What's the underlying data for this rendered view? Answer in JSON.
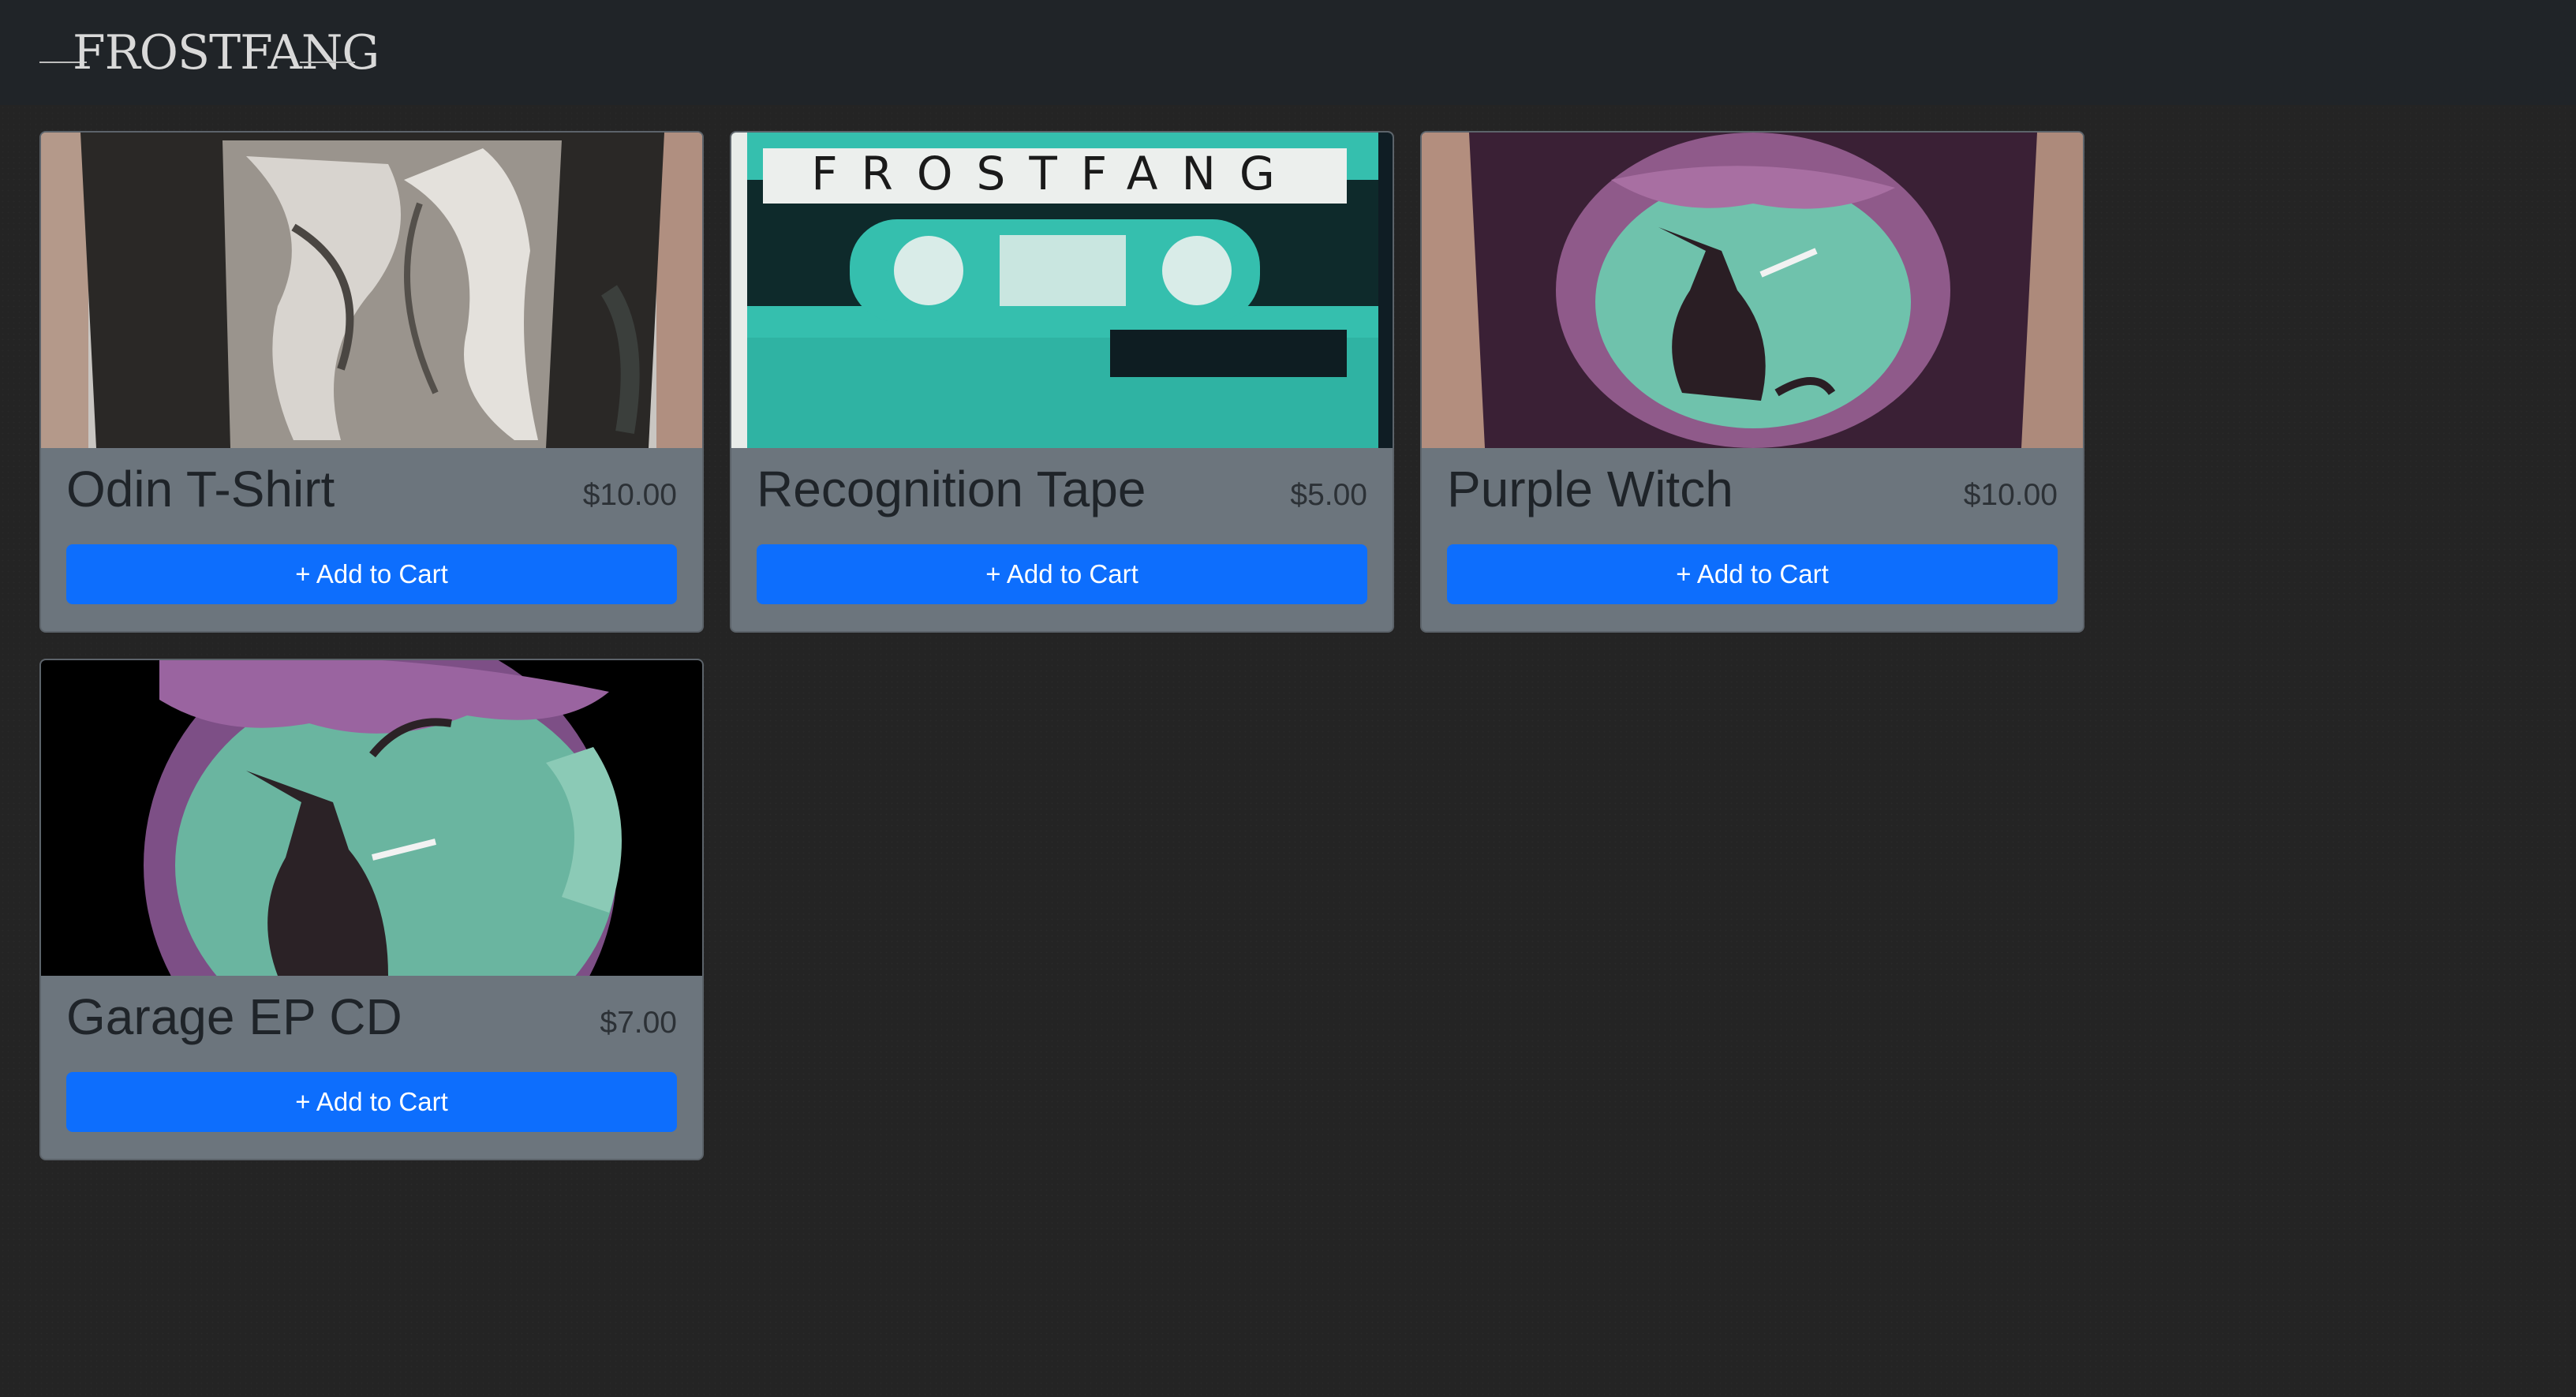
{
  "navbar": {
    "logo_text": "FROSTFANG"
  },
  "products": [
    {
      "name": "Odin T-Shirt",
      "price": "$10.00",
      "button_label": "+ Add to Cart"
    },
    {
      "name": "Recognition Tape",
      "price": "$5.00",
      "button_label": "+ Add to Cart",
      "image_text": "FROSTFANG"
    },
    {
      "name": "Purple Witch",
      "price": "$10.00",
      "button_label": "+ Add to Cart"
    },
    {
      "name": "Garage EP CD",
      "price": "$7.00",
      "button_label": "+ Add to Cart"
    }
  ],
  "colors": {
    "background": "#242424",
    "navbar": "#202428",
    "card": "#6c757d",
    "button": "#0d6efd"
  }
}
